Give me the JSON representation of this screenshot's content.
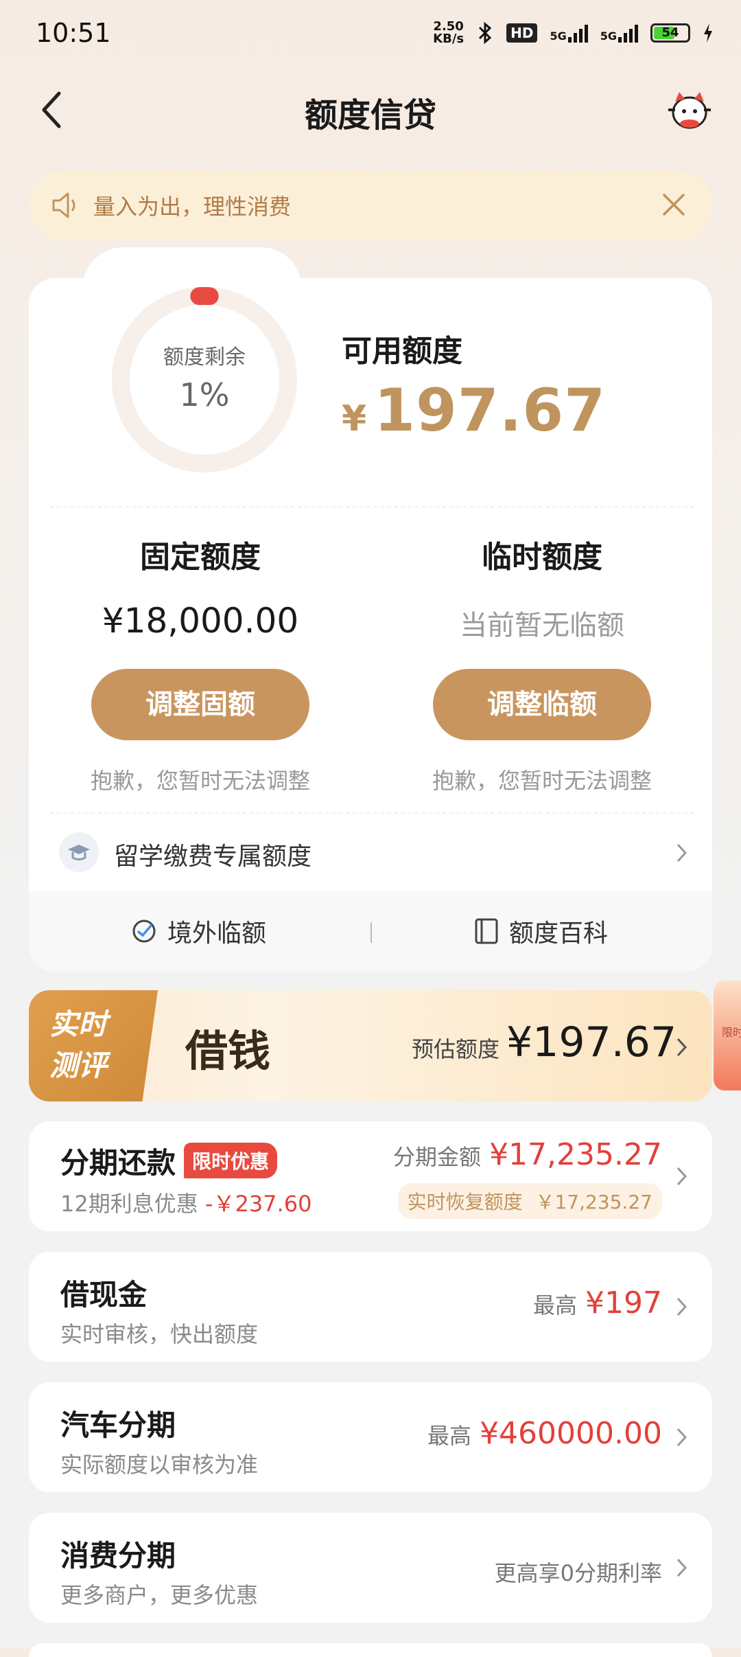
{
  "status_bar": {
    "time": "10:51",
    "net_speed_top": "2.50",
    "net_speed_bottom": "KB/s",
    "hd": "HD",
    "sim1": "5G",
    "sim2": "5G",
    "battery": "54"
  },
  "header": {
    "title": "额度信贷"
  },
  "notice": {
    "text": "量入为出，理性消费"
  },
  "credit": {
    "ring_label": "额度剩余",
    "ring_percent": "1%",
    "ring_fraction": 0.01,
    "available_label": "可用额度",
    "currency": "¥",
    "available_amount": "197.67",
    "fixed": {
      "title": "固定额度",
      "amount": "¥18,000.00",
      "button": "调整固额",
      "hint": "抱歉，您暂时无法调整"
    },
    "temp": {
      "title": "临时额度",
      "status": "当前暂无临额",
      "button": "调整临额",
      "hint": "抱歉，您暂时无法调整"
    },
    "study_abroad": "留学缴费专属额度",
    "footer_left": "境外临额",
    "footer_right": "额度百科"
  },
  "loan_banner": {
    "badge_line1": "实时",
    "badge_line2": "测评",
    "title": "借钱",
    "estimate_label": "预估额度",
    "estimate_amount": "¥197.67",
    "peek_text": "限时"
  },
  "installment": {
    "title": "分期还款",
    "tag": "限时优惠",
    "sub_prefix": "12期利息优惠",
    "sub_discount": "-￥237.60",
    "amount_label": "分期金额",
    "amount": "¥17,235.27",
    "recover_label": "实时恢复额度",
    "recover_amount": "￥17,235.27"
  },
  "cash": {
    "title": "借现金",
    "sub": "实时审核，快出额度",
    "max_label": "最高",
    "max_amount": "¥197"
  },
  "car": {
    "title": "汽车分期",
    "sub": "实际额度以审核为准",
    "max_label": "最高",
    "max_amount": "¥460000.00"
  },
  "consumer": {
    "title": "消费分期",
    "sub": "更多商户，更多优惠",
    "right": "更高享0分期利率"
  },
  "colors": {
    "accent_gold": "#c9955f",
    "price_red": "#e2403a",
    "notice_bg": "#fcefd8"
  }
}
